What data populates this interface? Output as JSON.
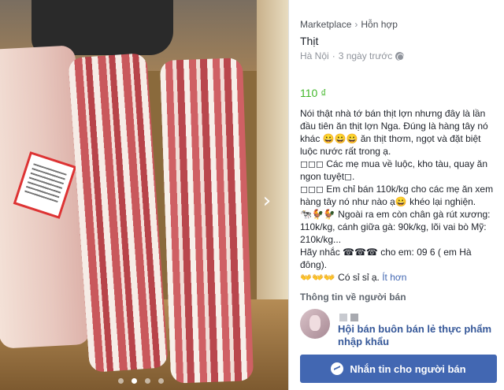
{
  "breadcrumb": {
    "root": "Marketplace",
    "separator": "›",
    "category": "Hỗn hợp"
  },
  "listing": {
    "title": "Thịt",
    "location": "Hà Nội",
    "posted": "3 ngày trước",
    "price": "110 ₫",
    "description": [
      "Nói thật nhà tớ bán thịt lợn nhưng  đây là lần đầu tiên ăn thịt lợn Nga. Đúng là hàng tây nó khác 😀😀😀 ăn thịt thơm, ngọt và đặt biệt luộc nước rất trong ạ.",
      "◻◻◻ Các mẹ mua về luộc, kho tàu, quay ăn ngon tuyệt◻.",
      "◻◻◻ Em chỉ bán 110k/kg cho các mẹ ăn xem hàng tây nó như nào ạ😀 khéo lại nghiện.",
      "🐄🐓🐓 Ngoài ra em còn chân gà rút xương: 110k/kg, cánh giữa gà: 90k/kg, lõi vai bò Mỹ: 210k/kg...",
      "Hãy nhắc ☎☎☎ cho em: 09          6 ( em          Hà đông).",
      "👐👐👐 Có sỉ sỉ ạ."
    ],
    "see_more": "Ít hơn"
  },
  "seller": {
    "heading": "Thông tin về người bán",
    "name": "Hội bán buôn bán lẻ thực phẩm nhập khẩu"
  },
  "actions": {
    "message_label": "Nhắn tin cho người bán"
  },
  "colors": {
    "accent": "#4267b2",
    "price": "#42b72a"
  },
  "icons": {
    "next": "chevron-right-icon",
    "globe": "globe-icon",
    "messenger": "messenger-icon"
  }
}
